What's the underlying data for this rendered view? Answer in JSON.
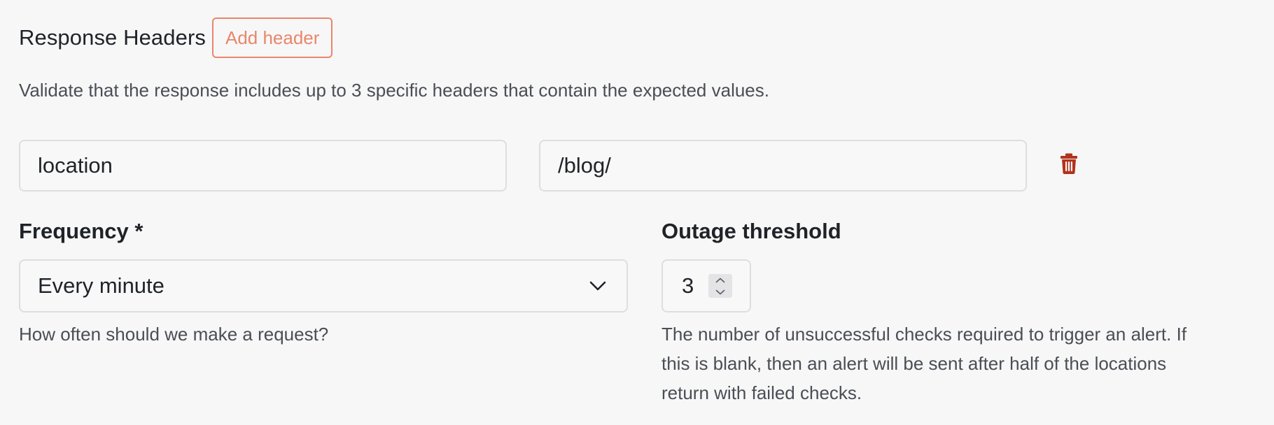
{
  "response_headers": {
    "title": "Response Headers",
    "add_button_label": "Add header",
    "description": "Validate that the response includes up to 3 specific headers that contain the expected values.",
    "rows": [
      {
        "name": "location",
        "value": "/blog/"
      }
    ],
    "delete_icon": "trash-icon",
    "delete_icon_color": "#b2331c"
  },
  "frequency": {
    "label": "Frequency *",
    "selected": "Every minute",
    "help": "How often should we make a request?",
    "chevron_icon": "chevron-down-icon"
  },
  "outage_threshold": {
    "label": "Outage threshold",
    "value": "3",
    "help_lines": [
      "The number of unsuccessful checks required to trigger an alert. If",
      "this is blank, then an alert will be sent after half of the locations",
      "return with failed checks."
    ]
  },
  "colors": {
    "accent": "#e8876b",
    "background": "#f7f7f7",
    "text": "#1f2328",
    "muted_text": "#4a4e55",
    "border": "#dedede"
  }
}
